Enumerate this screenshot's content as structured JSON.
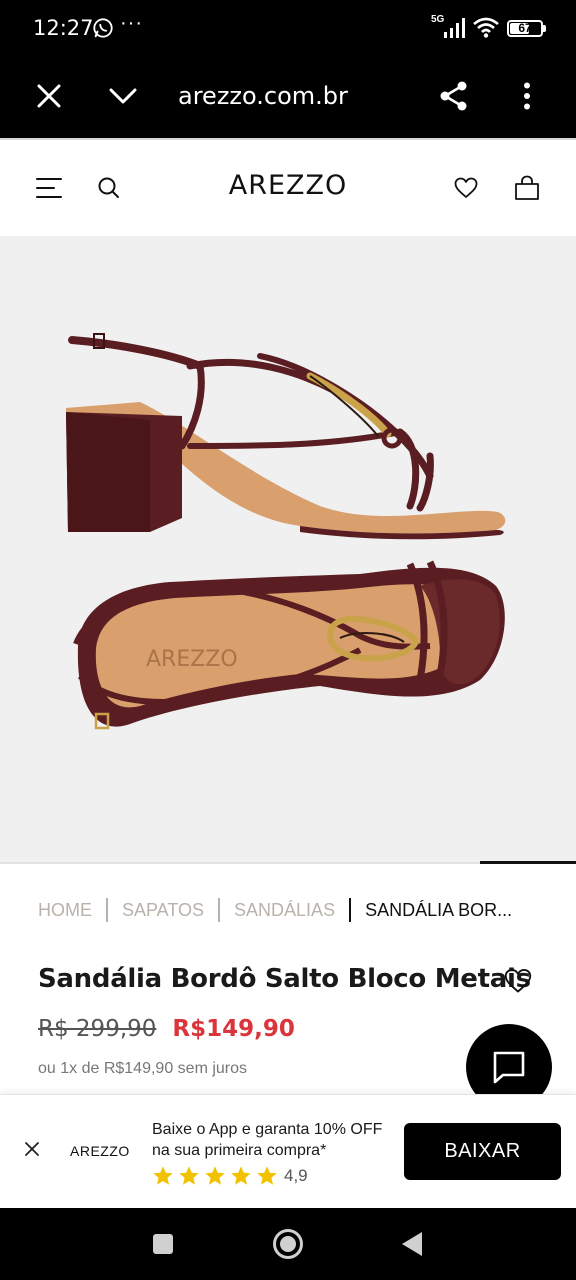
{
  "status_bar": {
    "time": "12:27",
    "overflow": "···",
    "network": "5G",
    "battery": "67",
    "battery_level": 0.67
  },
  "browser": {
    "url": "arezzo.com.br",
    "icons": [
      "close-icon",
      "chevron-down-icon",
      "share-icon",
      "more-vertical-icon"
    ]
  },
  "header": {
    "logo": "AREZZO",
    "icons": [
      "menu-icon",
      "search-icon",
      "heart-icon",
      "bag-icon"
    ]
  },
  "product_image": {
    "insole_brand": "AREZZO",
    "colors": {
      "leather": "#5a1e22",
      "insole": "#d99f6c",
      "hardware": "#c9a24a",
      "background": "#f0f0f0"
    }
  },
  "breadcrumb": {
    "items": [
      "HOME",
      "SAPATOS",
      "SANDÁLIAS"
    ],
    "current": "SANDÁLIA BOR..."
  },
  "product": {
    "title": "Sandália Bordô Salto Bloco Metais",
    "price_old": "R$ 299,90",
    "price_new": "R$149,90",
    "installments": "ou 1x de R$149,90 sem juros"
  },
  "app_banner": {
    "logo": "AREZZO",
    "text": "Baixe o App e garanta 10% OFF na sua primeira compra*",
    "rating": "4,9",
    "stars": 5,
    "button": "BAIXAR"
  },
  "colors": {
    "accent_price": "#d9353a",
    "star": "#f2c200",
    "breadcrumb_muted": "#b8b2aa"
  },
  "nav_bar": {
    "icons": [
      "recents-icon",
      "home-icon",
      "back-icon"
    ]
  }
}
